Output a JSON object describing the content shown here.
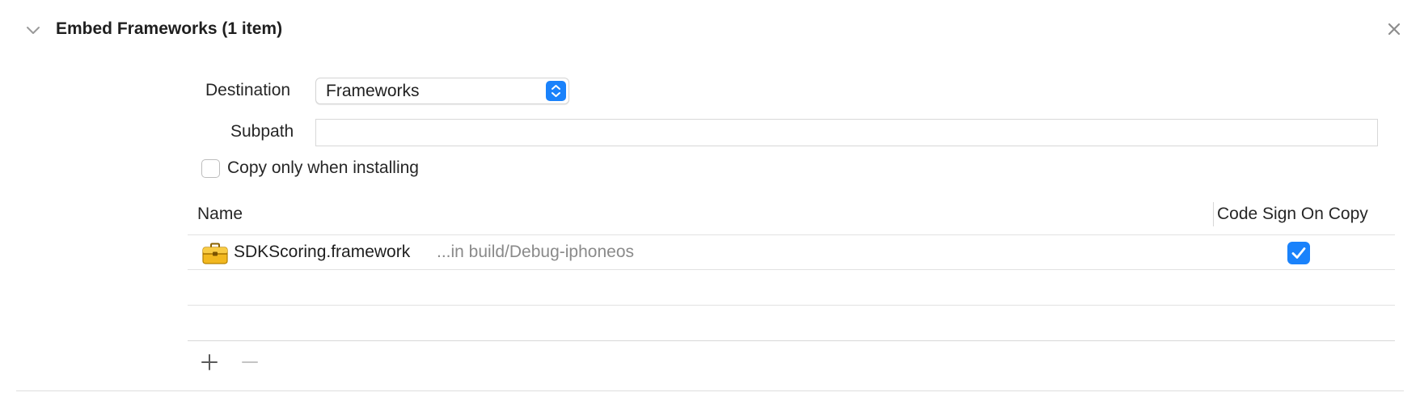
{
  "section": {
    "title": "Embed Frameworks (1 item)",
    "disclosure_icon": "chevron-down-icon",
    "close_icon": "close-icon"
  },
  "destination": {
    "label": "Destination",
    "value": "Frameworks",
    "stepper_icon": "up-down-chevron-icon"
  },
  "subpath": {
    "label": "Subpath",
    "value": "",
    "placeholder": ""
  },
  "copy_only_when_installing": {
    "label": "Copy only when installing",
    "checked": false
  },
  "table": {
    "columns": [
      "Name",
      "Code Sign On Copy"
    ],
    "rows": [
      {
        "icon": "toolbox-icon",
        "name": "SDKScoring.framework",
        "location": "...in build/Debug-iphoneos",
        "code_sign_on_copy": true
      }
    ]
  },
  "toolbar": {
    "add_icon": "plus-icon",
    "remove_icon": "minus-icon"
  },
  "colors": {
    "accent": "#1a82fb",
    "secondary_text": "#8a8a8a",
    "separator": "#e2e2e2"
  }
}
